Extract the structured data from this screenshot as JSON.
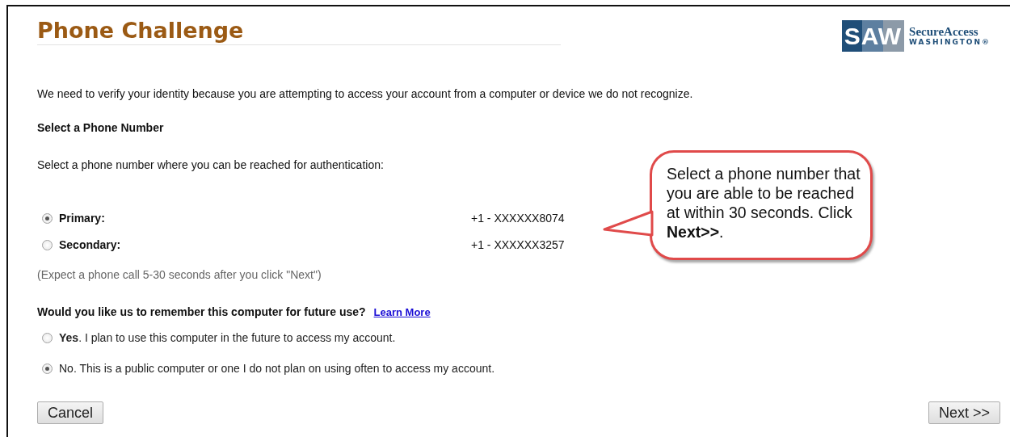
{
  "title": "Phone Challenge",
  "logo": {
    "mark": "SAW",
    "name": "SecureAccess",
    "subname": "WASHINGTON®"
  },
  "intro": "We need to verify your identity because you are attempting to access your account from a computer or device we do not recognize.",
  "phone_section": {
    "heading": "Select a Phone Number",
    "prompt": "Select a phone number where you can be reached for authentication:",
    "options": [
      {
        "label": "Primary:",
        "number": "+1 - XXXXXX8074",
        "selected": true
      },
      {
        "label": "Secondary:",
        "number": "+1 - XXXXXX3257",
        "selected": false
      }
    ],
    "hint": "(Expect a phone call 5-30 seconds after you click \"Next\")"
  },
  "remember_section": {
    "question": "Would you like us to remember this computer for future use?",
    "link": "Learn More",
    "options": [
      {
        "label": "**Yes**. I plan to use this computer in the future to access my account.",
        "selected": false
      },
      {
        "label": "No. This is a public computer or one I do not plan on using often to access my account.",
        "selected": true
      }
    ]
  },
  "callout": {
    "text": "Select a phone number that you are able to be reached at within 30 seconds. Click **Next>>**."
  },
  "buttons": {
    "cancel": "Cancel",
    "next": "Next >>"
  }
}
